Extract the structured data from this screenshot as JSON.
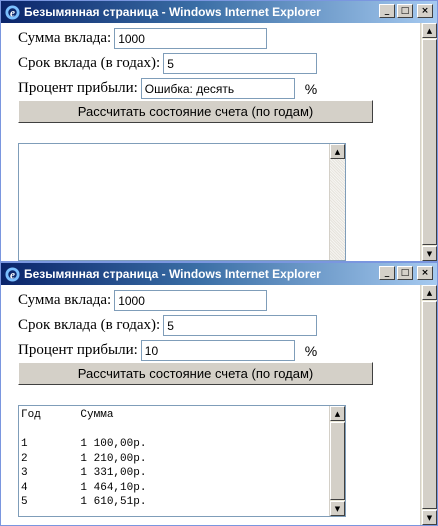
{
  "window_title": "Безымянная страница - Windows Internet Explorer",
  "titlebar_buttons": {
    "minimize": "_",
    "maximize": "□",
    "close": "×"
  },
  "labels": {
    "deposit": "Сумма вклада:",
    "term": "Срок вклада (в годах):",
    "rate": "Процент прибыли:",
    "percent_sign": "%",
    "calculate": "Рассчитать состояние счета (по годам)"
  },
  "window1": {
    "deposit_value": "1000",
    "term_value": "5",
    "rate_value": "Ошибка: десять",
    "output": ""
  },
  "window2": {
    "deposit_value": "1000",
    "term_value": "5",
    "rate_value": "10",
    "output_header": "Год      Сумма",
    "output_rows": [
      "1        1 100,00р.",
      "2        1 210,00р.",
      "3        1 331,00р.",
      "4        1 464,10р.",
      "5        1 610,51р."
    ]
  },
  "icons": {
    "app": "ie-icon",
    "up": "arrow-up-icon",
    "down": "arrow-down-icon"
  }
}
